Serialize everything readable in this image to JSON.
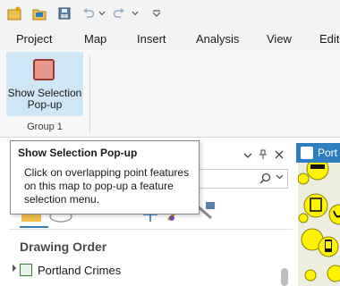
{
  "ribbon_tabs": [
    "Project",
    "Map",
    "Insert",
    "Analysis",
    "View",
    "Edit"
  ],
  "ribbon": {
    "selection_button": {
      "line1": "Show Selection",
      "line2": "Pop-up",
      "icon": "selection-popup-icon"
    },
    "group_label": "Group 1"
  },
  "tooltip": {
    "title": "Show Selection Pop-up",
    "body": "Click on overlapping point features on this map to pop-up a feature selection menu."
  },
  "contents_pane": {
    "section_title": "Drawing Order",
    "layer": "Portland Crimes"
  },
  "map_tab": {
    "label": "Port"
  },
  "colors": {
    "accent": "#2f7fbf",
    "selection_button_bg": "#cfe6f7",
    "selection_icon_fill": "#e8988b",
    "map_point": "#fff200"
  }
}
